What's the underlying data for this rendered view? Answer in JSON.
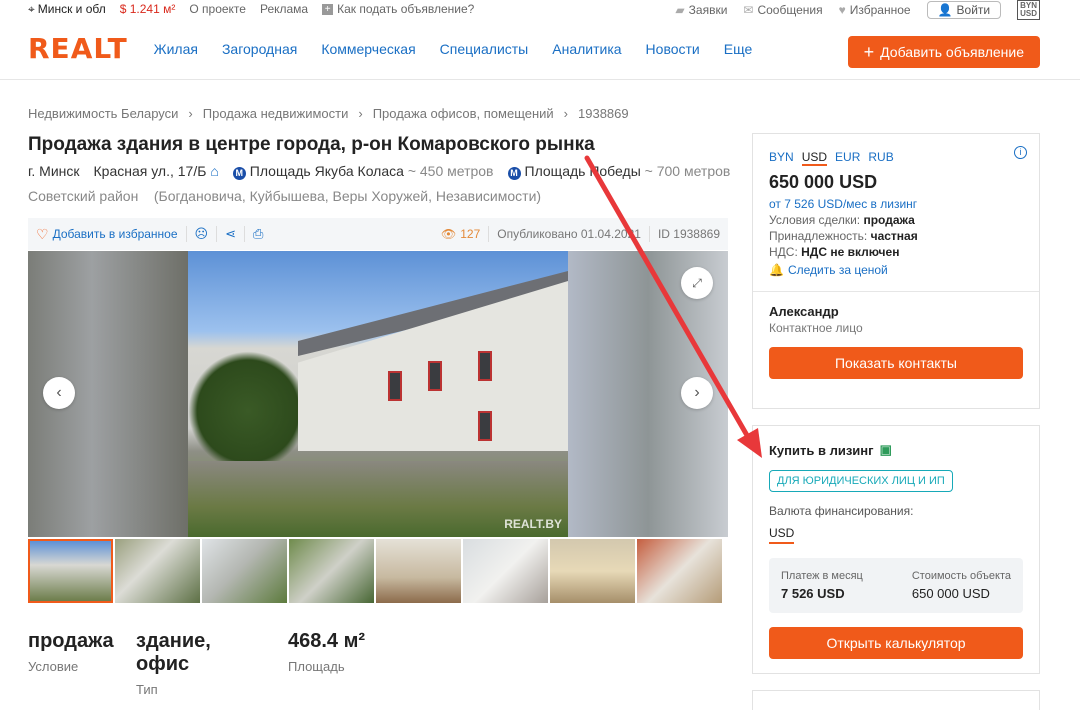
{
  "topbar": {
    "city": "Минск и обл",
    "rate": "$ 1.241 м²",
    "about": "О проекте",
    "ads": "Реклама",
    "how_to": "Как подать объявление?",
    "requests": "Заявки",
    "messages": "Сообщения",
    "favorites": "Избранное",
    "login": "Войти",
    "currency_top": "BYN",
    "currency_bottom": "USD"
  },
  "header": {
    "logo": "REALT",
    "nav": [
      "Жилая",
      "Загородная",
      "Коммерческая",
      "Специалисты",
      "Аналитика",
      "Новости",
      "Еще"
    ],
    "add_button": "Добавить объявление"
  },
  "breadcrumbs": [
    "Недвижимость Беларуси",
    "Продажа недвижимости",
    "Продажа офисов, помещений",
    "1938869"
  ],
  "listing": {
    "title": "Продажа здания в центре города, р-он Комаровского рынка",
    "city": "г. Минск",
    "street": "Красная ул., 17/Б",
    "metro1": "Площадь Якуба Коласа",
    "metro1_dist": "~ 450 метров",
    "metro2": "Площадь Победы",
    "metro2_dist": "~ 700 метров",
    "district": "Советский район",
    "streets_near": "(Богдановича, Куйбышева, Веры Хоружей, Независимости)",
    "toolbar_fav": "Добавить в избранное",
    "views": "127",
    "published": "Опубликовано 01.04.2021",
    "id": "ID 1938869",
    "watermark": "REALT.BY"
  },
  "facts": [
    {
      "value": "продажа",
      "label": "Условие"
    },
    {
      "value": "здание, офис",
      "label": "Тип"
    },
    {
      "value": "468.4 м²",
      "label": "Площадь"
    }
  ],
  "price_card": {
    "currencies": [
      "BYN",
      "USD",
      "EUR",
      "RUB"
    ],
    "active_currency": "USD",
    "price": "650 000 USD",
    "leasing_from": "от 7 526 USD/мес в лизинг",
    "terms_label": "Условия сделки:",
    "terms_value": "продажа",
    "owner_label": "Принадлежность:",
    "owner_value": "частная",
    "vat_label": "НДС:",
    "vat_value": "НДС не включен",
    "watch_price": "Следить за ценой",
    "contact_name": "Александр",
    "contact_role": "Контактное лицо",
    "show_contacts": "Показать контакты"
  },
  "leasing_card": {
    "title": "Купить в лизинг",
    "tag": "ДЛЯ ЮРИДИЧЕСКИХ ЛИЦ И ИП",
    "currency_label": "Валюта финансирования:",
    "currency_value": "USD",
    "monthly_label": "Платеж в месяц",
    "monthly_value": "7 526 USD",
    "cost_label": "Стоимость объекта",
    "cost_value": "650 000 USD",
    "calc_button": "Открыть калькулятор"
  },
  "colors": {
    "accent": "#f05a1a",
    "link": "#1a6fc4",
    "arrow": "#e8383a",
    "teal": "#17a9b8"
  }
}
